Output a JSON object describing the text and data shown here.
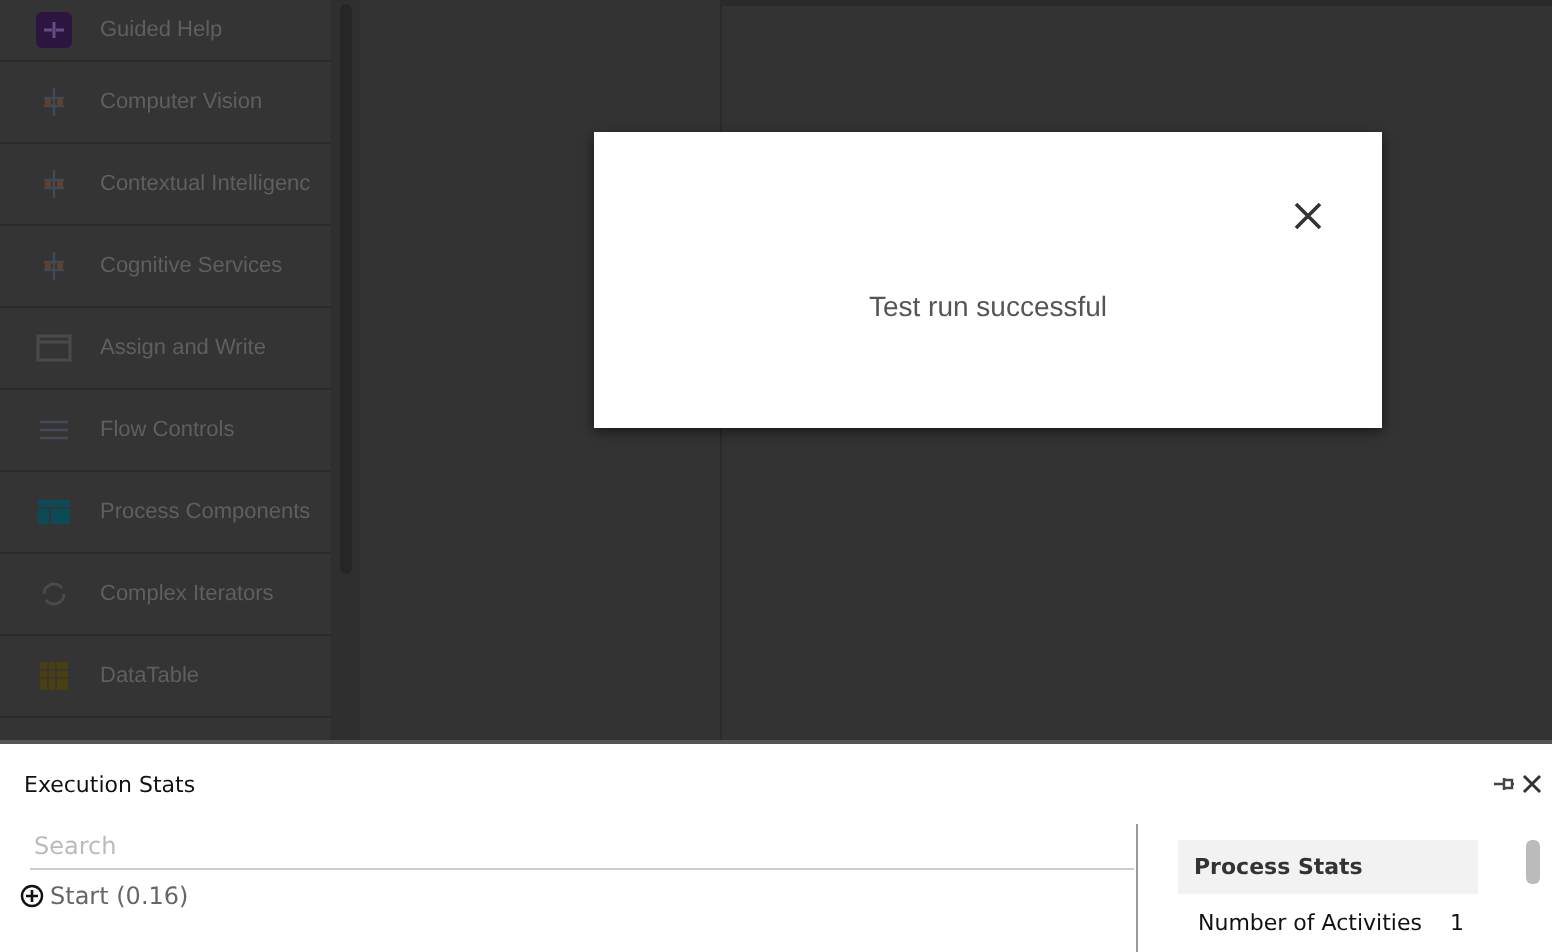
{
  "sidebar": {
    "items": [
      {
        "label": "Guided Help",
        "kind": "guided"
      },
      {
        "label": "Computer Vision",
        "kind": "ai"
      },
      {
        "label": "Contextual Intelligenc",
        "kind": "ai"
      },
      {
        "label": "Cognitive Services",
        "kind": "ai"
      },
      {
        "label": "Assign and Write",
        "kind": "assign"
      },
      {
        "label": "Flow Controls",
        "kind": "flow"
      },
      {
        "label": "Process Components",
        "kind": "process"
      },
      {
        "label": "Complex Iterators",
        "kind": "iterator"
      },
      {
        "label": "DataTable",
        "kind": "table"
      }
    ]
  },
  "dialog": {
    "message": "Test run successful"
  },
  "execution_panel": {
    "title": "Execution Stats",
    "search": {
      "placeholder": "Search"
    },
    "tree": [
      {
        "label": "Start (0.16)",
        "expanded": false
      }
    ],
    "process_stats": {
      "title": "Process Stats",
      "rows": [
        {
          "label": "Number of Activities",
          "value": "1"
        }
      ]
    }
  }
}
